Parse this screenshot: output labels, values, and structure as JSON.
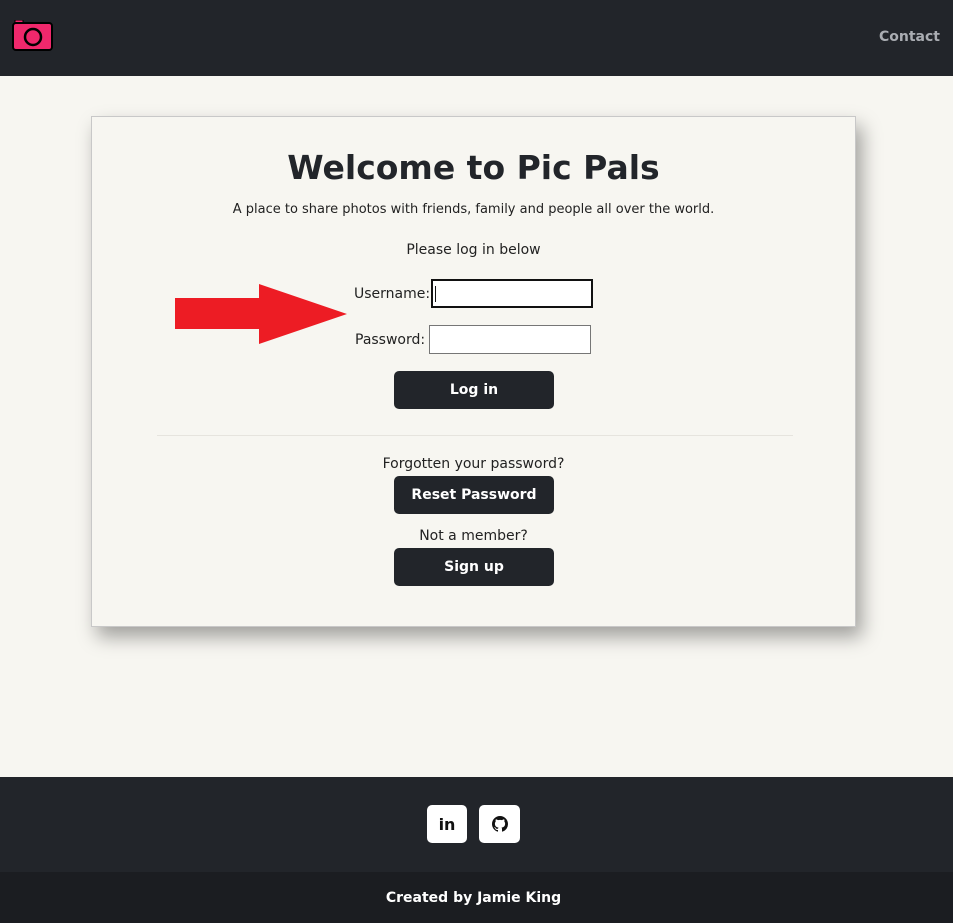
{
  "nav": {
    "logo_icon": "camera-icon",
    "contact_label": "Contact",
    "brand_color": "#f0286c"
  },
  "login": {
    "title": "Welcome to Pic Pals",
    "subtitle": "A place to share photos with friends, family and people all over the world.",
    "prompt": "Please log in below",
    "username_label": "Username:",
    "username_value": "",
    "password_label": "Password:",
    "password_value": "",
    "login_button": "Log in",
    "forgot_text": "Forgotten your password?",
    "reset_button": "Reset Password",
    "not_member_text": "Not a member?",
    "signup_button": "Sign up"
  },
  "annotation": {
    "arrow_icon": "right-arrow-icon",
    "arrow_color": "#ed1c24"
  },
  "footer": {
    "linkedin_label": "in",
    "linkedin_icon": "linkedin-icon",
    "github_icon": "github-icon",
    "credit": "Created by Jamie King"
  }
}
